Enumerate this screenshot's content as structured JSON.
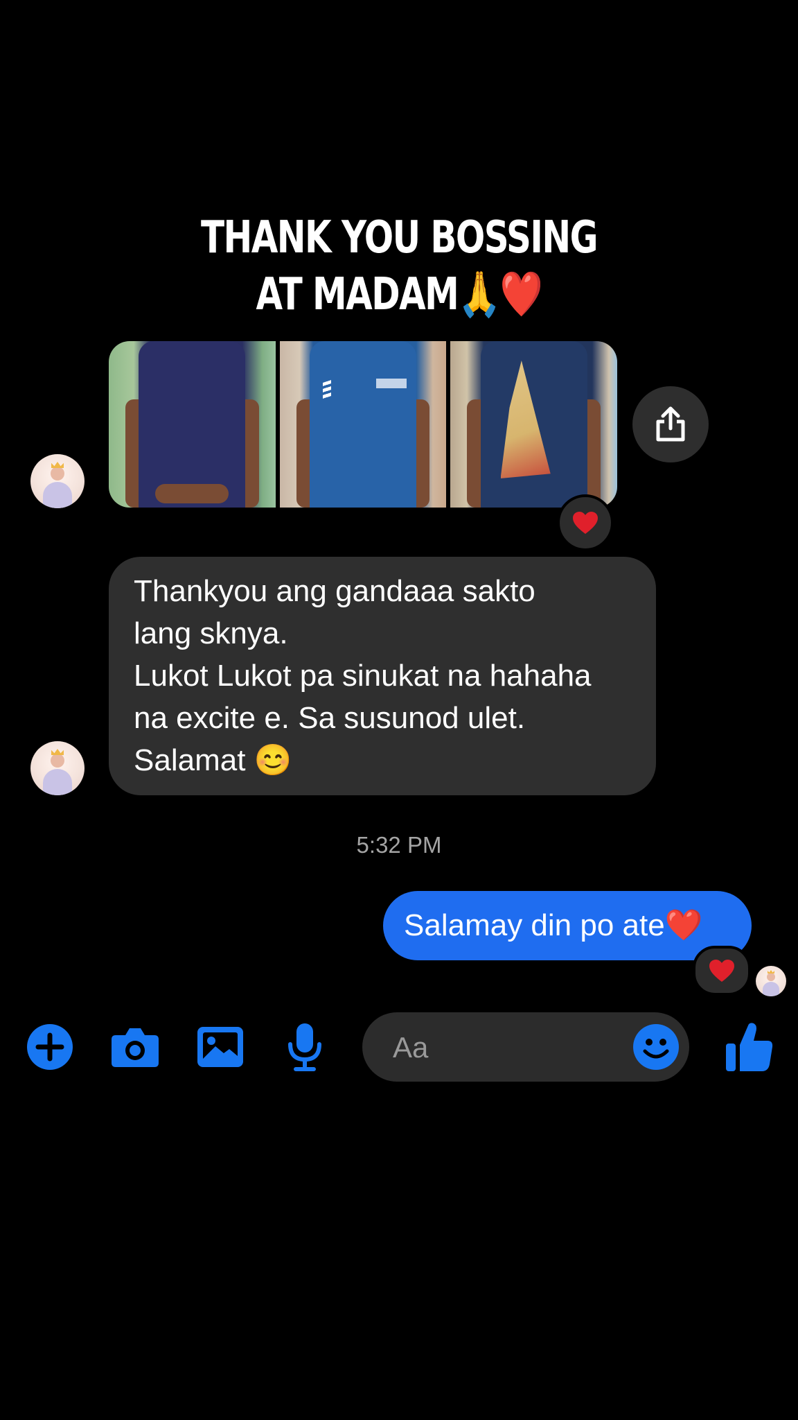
{
  "story_caption": {
    "line1": "THANK YOU BOSSING",
    "line2": "AT MADAM🙏❤️"
  },
  "conversation": {
    "messages": [
      {
        "sender": "contact",
        "type": "photo_set",
        "photo_count": 3,
        "reaction": "heart"
      },
      {
        "sender": "contact",
        "type": "text",
        "lines": [
          "Thankyou ang gandaaa sakto",
          "lang sknya.",
          "Lukot Lukot pa sinukat na hahaha",
          "na excite e. Sa susunod ulet.",
          "Salamat 😊"
        ]
      },
      {
        "sender": "me",
        "type": "text",
        "text": "Salamay din po ate❤️",
        "reaction": "heart"
      }
    ],
    "timestamp": "5:32 PM"
  },
  "composer": {
    "placeholder": "Aa",
    "icons": [
      "plus-icon",
      "camera-icon",
      "gallery-icon",
      "microphone-icon",
      "emoji-icon",
      "thumbs-up-icon"
    ]
  },
  "colors": {
    "background": "#000000",
    "incoming_bubble": "#2f2f2f",
    "outgoing_bubble": "#1f6df0",
    "accent": "#1877f2",
    "timestamp": "#a4a4a4",
    "heart": "#e0202b"
  }
}
